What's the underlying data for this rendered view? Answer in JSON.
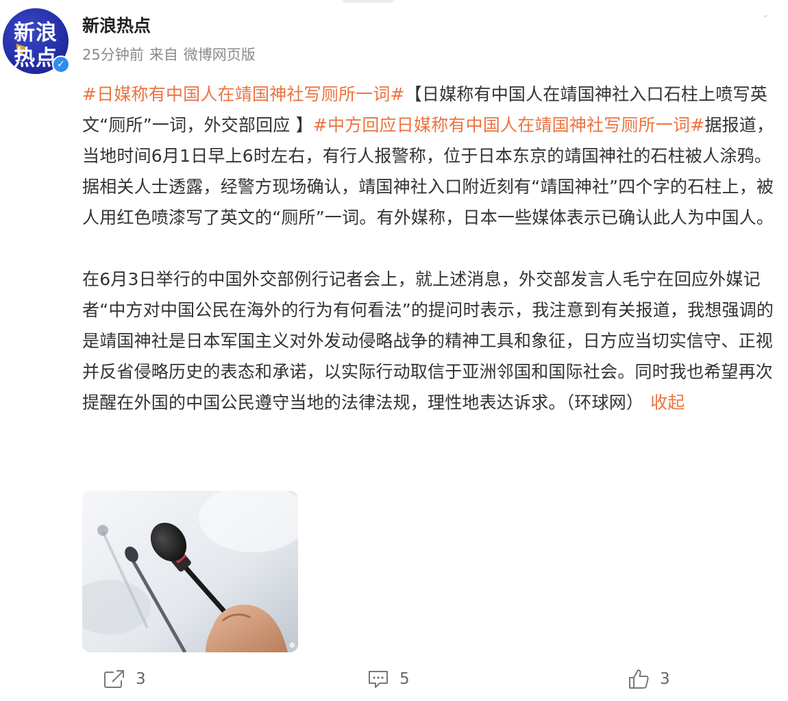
{
  "header": {
    "avatar_top": "新浪",
    "avatar_bottom": "热点",
    "author_name": "新浪热点",
    "time": "25分钟前",
    "source_prefix": "来自",
    "source_name": "微博网页版"
  },
  "post": {
    "topic1": "#日媒称有中国人在靖国神社写厕所一词#",
    "text1": "【日媒称有中国人在靖国神社入口石柱上喷写英文“厕所”一词，外交部回应 】",
    "topic2": "#中方回应日媒称有中国人在靖国神社写厕所一词#",
    "text2": "据报道，当地时间6月1日早上6时左右，有行人报警称，位于日本东京的靖国神社的石柱被人涂鸦。据相关人士透露，经警方现场确认，靖国神社入口附近刻有“靖国神社”四个字的石柱上，被人用红色喷漆写了英文的“厕所”一词。有外媒称，日本一些媒体表示已确认此人为中国人。",
    "paragraph2": "在6月3日举行的中国外交部例行记者会上，就上述消息，外交部发言人毛宁在回应外媒记者“中方对中国公民在海外的行为有何看法”的提问时表示，我注意到有关报道，我想强调的是靖国神社是日本军国主义对外发动侵略战争的精神工具和象征，日方应当切实信守、正视并反省侵略历史的表态和承诺，以实际行动取信于亚洲邻国和国际社会。同时我也希望再次提醒在外国的中国公民遵守当地的法律法规，理性地表达诉求。（环球网）",
    "collapse_label": "收起"
  },
  "image": {
    "description_icon": "microphone-photo"
  },
  "footer": {
    "share_count": "3",
    "comment_count": "5",
    "like_count": "3"
  },
  "colors": {
    "accent": "#eb7340",
    "text": "#333333",
    "meta": "#8a8a8a",
    "avatar_bg": "#1f2a9e",
    "verified": "#2f8cf0"
  }
}
